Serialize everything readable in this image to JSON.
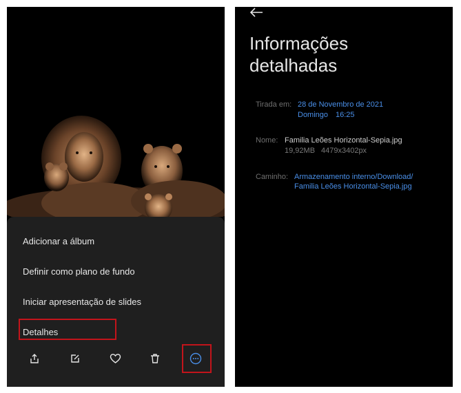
{
  "left_screen": {
    "menu": {
      "add_album": "Adicionar a álbum",
      "set_wallpaper": "Definir como plano de fundo",
      "slideshow": "Iniciar apresentação de slides",
      "details": "Detalhes"
    },
    "toolbar_icons": [
      "share-icon",
      "edit-icon",
      "heart-icon",
      "trash-icon",
      "more-icon"
    ],
    "highlight_color": "#c3141b"
  },
  "right_screen": {
    "title_line1": "Informações",
    "title_line2": "detalhadas",
    "taken": {
      "label": "Tirada em:",
      "date": "28 de Novembro de 2021",
      "weekday": "Domingo",
      "time": "16:25"
    },
    "name": {
      "label": "Nome:",
      "filename": "Familia Leões Horizontal-Sepia.jpg",
      "size": "19,92MB",
      "resolution": "4479x3402px"
    },
    "path": {
      "label": "Caminho:",
      "line1": "Armazenamento interno/Download/",
      "line2": "Familia Leões Horizontal-Sepia.jpg"
    },
    "accent_color": "#4a8fe8"
  }
}
